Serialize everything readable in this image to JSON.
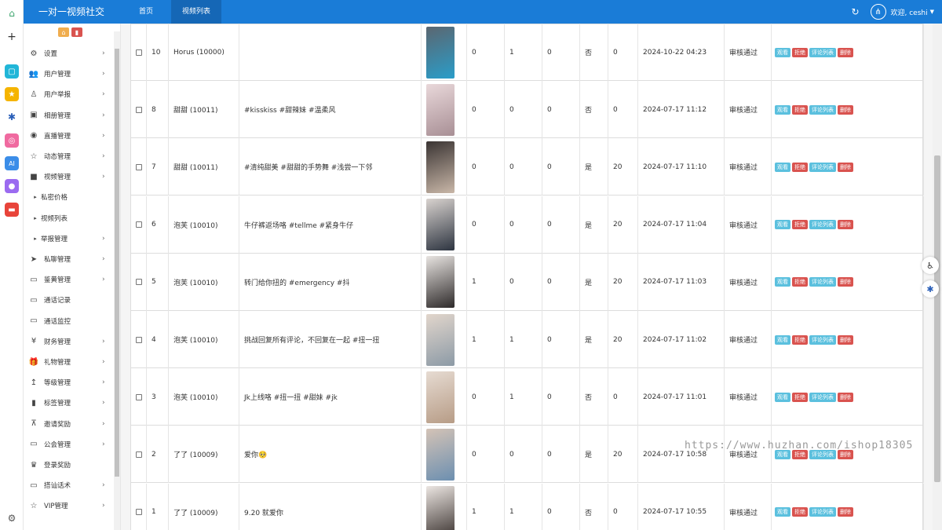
{
  "topbar": {
    "brand": "一对一视频社交",
    "nav": [
      "首页",
      "视频列表"
    ],
    "welcome": "欢迎, ceshi"
  },
  "sidebar": {
    "top_buttons": [
      "home",
      "delete"
    ],
    "items": [
      {
        "label": "设置",
        "icon": "gears-icon",
        "arrow": true
      },
      {
        "label": "用户管理",
        "icon": "users-icon",
        "arrow": true
      },
      {
        "label": "用户举报",
        "icon": "report-icon",
        "arrow": true
      },
      {
        "label": "相册管理",
        "icon": "image-icon",
        "arrow": true
      },
      {
        "label": "直播管理",
        "icon": "eye-icon",
        "arrow": true
      },
      {
        "label": "动态管理",
        "icon": "star-icon",
        "arrow": true
      },
      {
        "label": "视频管理",
        "icon": "video-icon",
        "arrow": true
      },
      {
        "label": "私密价格",
        "icon": "caret-icon",
        "arrow": false,
        "sub": true
      },
      {
        "label": "视频列表",
        "icon": "caret-icon",
        "arrow": false,
        "sub": true
      },
      {
        "label": "举报管理",
        "icon": "caret-icon",
        "arrow": true,
        "sub": true
      },
      {
        "label": "私聊管理",
        "icon": "send-icon",
        "arrow": true
      },
      {
        "label": "鉴黄管理",
        "icon": "monitor-icon",
        "arrow": true
      },
      {
        "label": "通话记录",
        "icon": "monitor-icon",
        "arrow": false
      },
      {
        "label": "通话监控",
        "icon": "monitor-icon",
        "arrow": false
      },
      {
        "label": "财务管理",
        "icon": "yen-icon",
        "arrow": true
      },
      {
        "label": "礼物管理",
        "icon": "gift-icon",
        "arrow": true
      },
      {
        "label": "等级管理",
        "icon": "level-icon",
        "arrow": true
      },
      {
        "label": "标签管理",
        "icon": "bookmark-icon",
        "arrow": true
      },
      {
        "label": "邀请奖励",
        "icon": "sitemap-icon",
        "arrow": true
      },
      {
        "label": "公会管理",
        "icon": "monitor-icon",
        "arrow": true
      },
      {
        "label": "登录奖励",
        "icon": "trophy-icon",
        "arrow": false
      },
      {
        "label": "搭讪话术",
        "icon": "monitor-icon",
        "arrow": true
      },
      {
        "label": "VIP管理",
        "icon": "star-icon",
        "arrow": true
      }
    ]
  },
  "table": {
    "action_labels": {
      "view": "观看",
      "reject": "拒绝",
      "comments": "评论列表",
      "delete": "删除"
    },
    "rows": [
      {
        "id": "10",
        "user": "Horus (10000)",
        "title": "",
        "thumb": [
          "#5b6670",
          "#2a9dc9"
        ],
        "c1": "0",
        "c2": "1",
        "c3": "0",
        "private": "否",
        "price": "0",
        "time": "2024-10-22 04:23",
        "status": "审核通过"
      },
      {
        "id": "8",
        "user": "甜甜 (10011)",
        "title": "#kisskiss #甜辣妹 #温柔风",
        "thumb": [
          "#e9d8da",
          "#a88f95"
        ],
        "c1": "0",
        "c2": "0",
        "c3": "0",
        "private": "否",
        "price": "0",
        "time": "2024-07-17 11:12",
        "status": "审核通过"
      },
      {
        "id": "7",
        "user": "甜甜 (10011)",
        "title": "#清纯甜美 #甜甜的手势舞 #浅尝一下邻",
        "thumb": [
          "#3a3433",
          "#c9b7a8"
        ],
        "c1": "0",
        "c2": "0",
        "c3": "0",
        "private": "是",
        "price": "20",
        "time": "2024-07-17 11:10",
        "status": "审核通过"
      },
      {
        "id": "6",
        "user": "泡芙 (10010)",
        "title": "牛仔裤返场咯 #tellme #紧身牛仔",
        "thumb": [
          "#d9d3cf",
          "#2d3440"
        ],
        "c1": "0",
        "c2": "0",
        "c3": "0",
        "private": "是",
        "price": "20",
        "time": "2024-07-17 11:04",
        "status": "审核通过"
      },
      {
        "id": "5",
        "user": "泡芙 (10010)",
        "title": "转门给你扭的 #emergency #抖",
        "thumb": [
          "#e8e4e1",
          "#2e2a2a"
        ],
        "c1": "1",
        "c2": "0",
        "c3": "0",
        "private": "是",
        "price": "20",
        "time": "2024-07-17 11:03",
        "status": "审核通过"
      },
      {
        "id": "4",
        "user": "泡芙 (10010)",
        "title": "挑战回复所有评论，不回复在一起 #扭一扭",
        "thumb": [
          "#e2d6cc",
          "#8c9aa6"
        ],
        "c1": "1",
        "c2": "1",
        "c3": "0",
        "private": "是",
        "price": "20",
        "time": "2024-07-17 11:02",
        "status": "审核通过"
      },
      {
        "id": "3",
        "user": "泡芙 (10010)",
        "title": "Jk上线咯 #扭一扭 #甜妹 #jk",
        "thumb": [
          "#e6dbd2",
          "#b79c86"
        ],
        "c1": "0",
        "c2": "1",
        "c3": "0",
        "private": "否",
        "price": "0",
        "time": "2024-07-17 11:01",
        "status": "审核通过"
      },
      {
        "id": "2",
        "user": "了了 (10009)",
        "title": "爱你🥺",
        "thumb": [
          "#d4c3b6",
          "#6c8fb0"
        ],
        "c1": "0",
        "c2": "0",
        "c3": "0",
        "private": "是",
        "price": "20",
        "time": "2024-07-17 10:58",
        "status": "审核通过"
      },
      {
        "id": "1",
        "user": "了了 (10009)",
        "title": "9.20 就爱你",
        "thumb": [
          "#ece6e2",
          "#3b3330"
        ],
        "c1": "1",
        "c2": "1",
        "c3": "0",
        "private": "否",
        "price": "0",
        "time": "2024-07-17 10:55",
        "status": "审核通过"
      }
    ]
  },
  "watermark": "https://www.huzhan.com/ishop18305",
  "colors": {
    "brand": "#1a7cd7",
    "info": "#5bc0de",
    "danger": "#d9534f"
  }
}
